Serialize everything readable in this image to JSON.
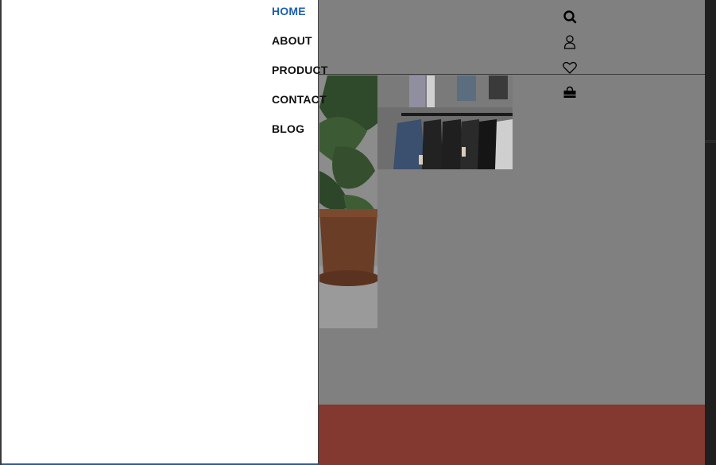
{
  "nav": {
    "items": [
      {
        "label": "HOME",
        "active": true
      },
      {
        "label": "ABOUT",
        "active": false
      },
      {
        "label": "PRODUCT",
        "active": false
      },
      {
        "label": "CONTACT",
        "active": false
      },
      {
        "label": "BLOG",
        "active": false
      }
    ]
  },
  "header_icons": [
    "search-icon",
    "user-icon",
    "heart-icon",
    "shopping-bag-icon"
  ],
  "colors": {
    "accent": "#1c5fb0",
    "overlay_dim": "#808080",
    "footer_band": "#833830",
    "panel": "#ffffff"
  }
}
